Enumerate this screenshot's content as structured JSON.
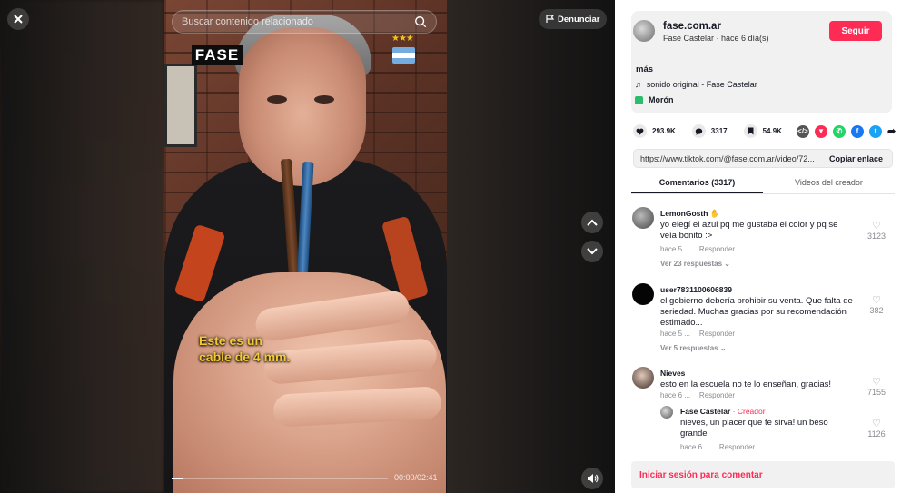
{
  "search": {
    "placeholder": "Buscar contenido relacionado"
  },
  "report_label": "Denunciar",
  "video": {
    "logo_text": "FASE",
    "caption": "Este es un\ncable de 4 mm.",
    "time": "00:00/02:41",
    "progress_fraction": 0.05
  },
  "author": {
    "handle": "fase.com.ar",
    "subtitle": "Fase Castelar · hace 6 día(s)",
    "follow_label": "Seguir",
    "more_label": "más",
    "sound": "sonido original - Fase Castelar",
    "location": "Morón"
  },
  "stats": {
    "likes": "293.9K",
    "comments": "3317",
    "saves": "54.9K"
  },
  "share": {
    "url": "https://www.tiktok.com/@fase.com.ar/video/72...",
    "copy_label": "Copiar enlace"
  },
  "tabs": [
    {
      "label": "Comentarios (3317)"
    },
    {
      "label": "Videos del creador"
    }
  ],
  "comments": [
    {
      "user": "LemonGosth",
      "text": "yo elegí el azul pq me gustaba el color y pq se veía bonito :>",
      "time": "hace 5 ...",
      "reply": "Responder",
      "likes": "3123",
      "replies": "Ver 23 respuestas"
    },
    {
      "user": "user7831100606839",
      "text": "el gobierno debería prohibir su venta. Que falta de seriedad. Muchas gracias por su recomendación estimado...",
      "time": "hace 5 ...",
      "reply": "Responder",
      "likes": "382",
      "replies": "Ver 5 respuestas"
    },
    {
      "user": "Nieves",
      "text": "esto en la escuela no te lo enseñan, gracias!",
      "time": "hace 6 ...",
      "reply": "Responder",
      "likes": "7155"
    }
  ],
  "creator_reply": {
    "user": "Fase Castelar",
    "tag": " · Creador",
    "text": "nieves, un placer que te sirva! un beso grande",
    "time": "hace 6 ...",
    "reply": "Responder",
    "likes": "1126"
  },
  "login_label": "Iniciar sesión para comentar",
  "colors": {
    "accent": "#fe2c55",
    "panel_bg": "#ffffff",
    "card_bg": "#f1f1f2"
  }
}
